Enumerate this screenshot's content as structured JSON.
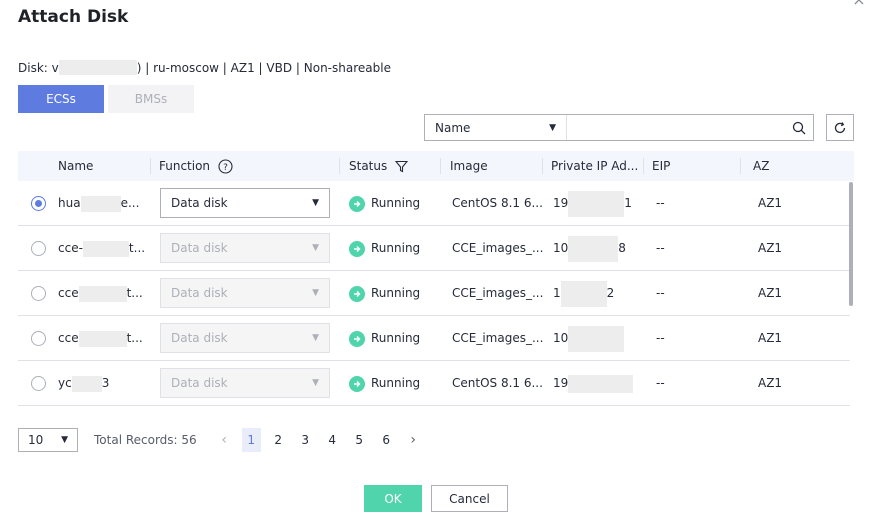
{
  "dialog": {
    "title": "Attach Disk",
    "close_glyph": "×"
  },
  "disk_info": {
    "prefix": "Disk: v",
    "suffix": ") | ru-moscow  | AZ1  | VBD  | Non-shareable"
  },
  "tabs": [
    {
      "label": "ECSs",
      "active": true
    },
    {
      "label": "BMSs",
      "active": false
    }
  ],
  "search": {
    "field_value": "Name",
    "input_value": "",
    "icon": "search-icon"
  },
  "refresh": {
    "icon": "refresh-icon"
  },
  "table": {
    "headers": {
      "name": "Name",
      "function": "Function",
      "status": "Status",
      "image": "Image",
      "private_ip": "Private IP Ad...",
      "eip": "EIP",
      "az": "AZ"
    },
    "rows": [
      {
        "selected": true,
        "name_prefix": "hua",
        "name_suffix": "e...",
        "function": "Data disk",
        "function_enabled": true,
        "status": "Running",
        "image": "CentOS 8.1 6...",
        "ip_prefix": "19",
        "ip_suffix": "1",
        "eip": "--",
        "az": "AZ1"
      },
      {
        "selected": false,
        "name_prefix": "cce-",
        "name_suffix": "t...",
        "function": "Data disk",
        "function_enabled": false,
        "status": "Running",
        "image": "CCE_images_...",
        "ip_prefix": "10",
        "ip_suffix": "8",
        "eip": "--",
        "az": "AZ1"
      },
      {
        "selected": false,
        "name_prefix": "cce",
        "name_suffix": "t...",
        "function": "Data disk",
        "function_enabled": false,
        "status": "Running",
        "image": "CCE_images_...",
        "ip_prefix": "1",
        "ip_suffix": "2",
        "eip": "--",
        "az": "AZ1"
      },
      {
        "selected": false,
        "name_prefix": "cce",
        "name_suffix": "t...",
        "function": "Data disk",
        "function_enabled": false,
        "status": "Running",
        "image": "CCE_images_...",
        "ip_prefix": "10",
        "ip_suffix": "",
        "eip": "--",
        "az": "AZ1"
      },
      {
        "selected": false,
        "name_prefix": "yc",
        "name_suffix": "3",
        "function": "Data disk",
        "function_enabled": false,
        "status": "Running",
        "image": "CentOS 8.1 6...",
        "ip_prefix": "19",
        "ip_suffix": "",
        "eip": "--",
        "az": "AZ1"
      }
    ]
  },
  "pagination": {
    "page_size": "10",
    "total": "Total Records: 56",
    "pages": [
      "1",
      "2",
      "3",
      "4",
      "5",
      "6"
    ],
    "current_page": "1",
    "prev_glyph": "‹",
    "next_glyph": "›"
  },
  "footer": {
    "ok_label": "OK",
    "cancel_label": "Cancel"
  },
  "colors": {
    "accent": "#5e7ce0",
    "success": "#50d4ab",
    "border": "#adb0b8",
    "header_bg": "#f3f6fc"
  }
}
